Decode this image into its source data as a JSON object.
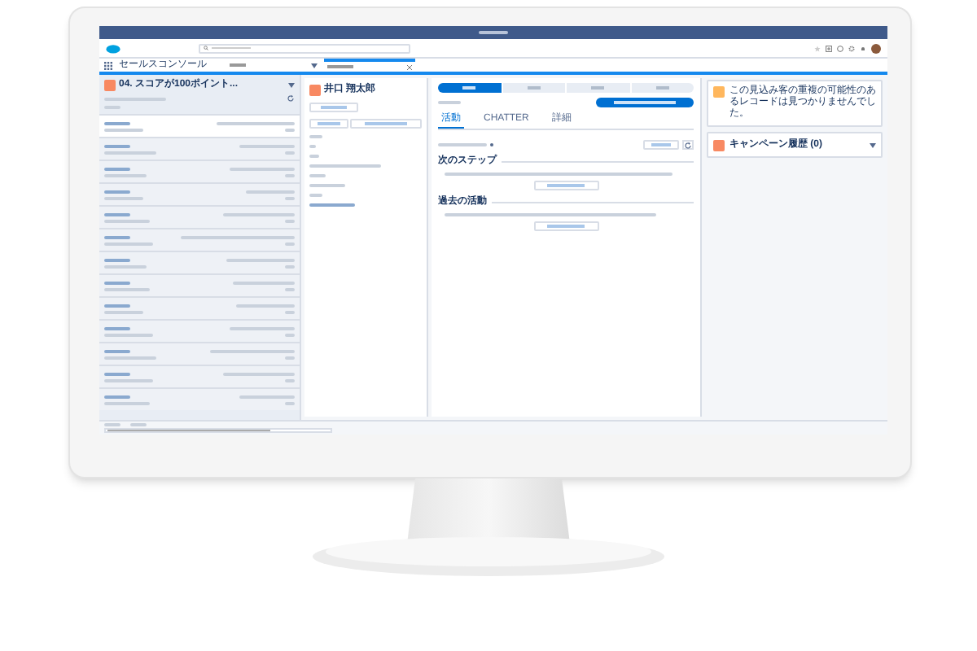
{
  "nav": {
    "app_name": "セールスコンソール",
    "tabs": [
      {
        "selected": true
      }
    ]
  },
  "list_view": {
    "title": "04. スコアが100ポイント...",
    "rows": [
      {
        "selected": true
      },
      {
        "selected": false
      },
      {
        "selected": false
      },
      {
        "selected": false
      },
      {
        "selected": false
      },
      {
        "selected": false
      },
      {
        "selected": false
      },
      {
        "selected": false
      },
      {
        "selected": false
      },
      {
        "selected": false
      },
      {
        "selected": false
      },
      {
        "selected": false
      },
      {
        "selected": false
      }
    ]
  },
  "record": {
    "name": "井口 翔太郎"
  },
  "path": {
    "stages": [
      {
        "selected": true
      },
      {
        "selected": false
      },
      {
        "selected": false
      },
      {
        "selected": false
      }
    ]
  },
  "detail_tabs": [
    {
      "label": "活動",
      "selected": true
    },
    {
      "label": "CHATTER",
      "selected": false
    },
    {
      "label": "詳細",
      "selected": false
    }
  ],
  "activity": {
    "sections": [
      {
        "title": "次のステップ"
      },
      {
        "title": "過去の活動"
      }
    ]
  },
  "sidebar": {
    "duplicate_notice": "この見込み客の重複の可能性のあるレコードは見つかりませんでした。",
    "campaign_history": "キャンペーン履歴 (0)"
  }
}
